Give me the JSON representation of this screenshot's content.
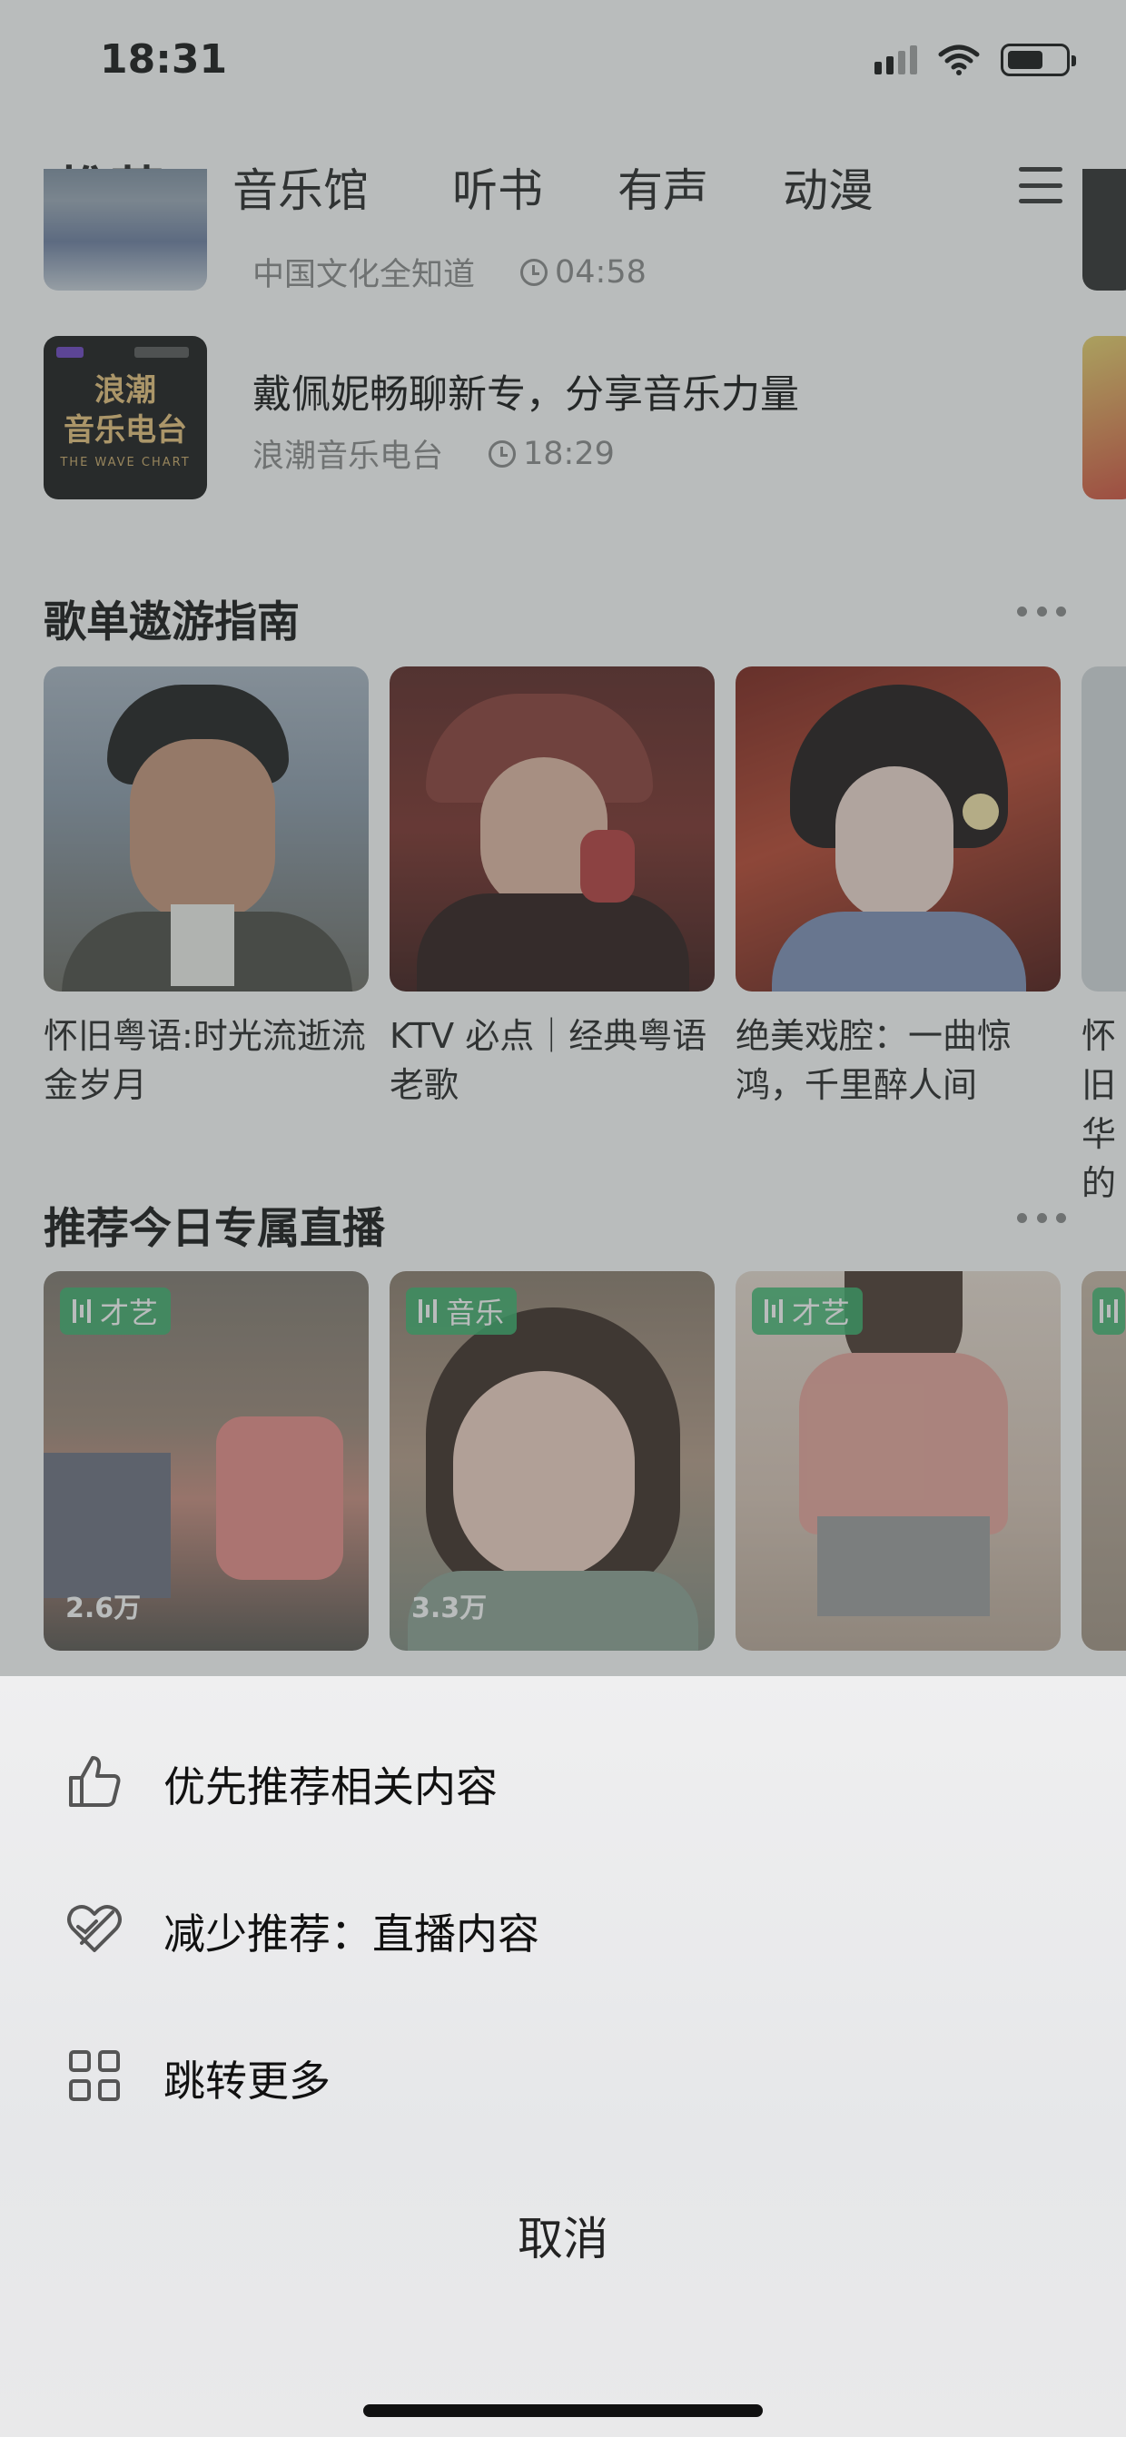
{
  "status_bar": {
    "time": "18:31"
  },
  "tabs": [
    {
      "label": "推荐",
      "active": true
    },
    {
      "label": "音乐馆"
    },
    {
      "label": "听书"
    },
    {
      "label": "有声"
    },
    {
      "label": "动漫"
    }
  ],
  "radio_list": [
    {
      "title": "",
      "source": "中国文化全知道",
      "duration": "04:58"
    },
    {
      "title": "戴佩妮畅聊新专，分享音乐力量",
      "source": "浪潮音乐电台",
      "duration": "18:29",
      "cover_text": "浪潮\n音乐电台",
      "cover_sub": "THE WAVE CHART"
    }
  ],
  "playlist_section": {
    "title": "歌单遨游指南",
    "cards": [
      {
        "title": "怀旧粤语:时光流逝流金岁月"
      },
      {
        "title": "KTV 必点｜经典粤语老歌"
      },
      {
        "title": "绝美戏腔：一曲惊鸿，千里醉人间"
      },
      {
        "title": "怀旧华的"
      }
    ]
  },
  "live_section": {
    "title": "推荐今日专属直播",
    "cards": [
      {
        "tag": "才艺",
        "count": "2.6万"
      },
      {
        "tag": "音乐",
        "count": "3.3万"
      },
      {
        "tag": "才艺",
        "count": ""
      }
    ]
  },
  "action_sheet": {
    "items": [
      {
        "label": "优先推荐相关内容",
        "icon": "thumbs-up-icon"
      },
      {
        "label": "减少推荐：直播内容",
        "icon": "heart-slash-icon"
      },
      {
        "label": "跳转更多",
        "icon": "grid-icon"
      }
    ],
    "cancel_label": "取消"
  },
  "colors": {
    "accent": "#35b56b",
    "overlay": "#46504e"
  }
}
